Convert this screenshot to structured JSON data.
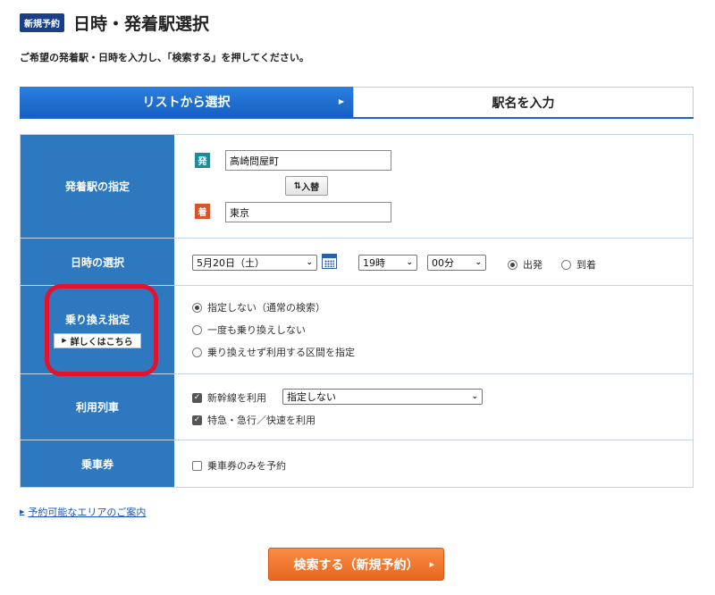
{
  "header": {
    "badge": "新規予約",
    "title": "日時・発着駅選択"
  },
  "instruction": "ご希望の発着駅・日時を入力し、「検索する」を押してください。",
  "tabs": {
    "list_label": "リストから選択",
    "name_label": "駅名を入力"
  },
  "rows": {
    "stations": {
      "label": "発着駅の指定",
      "departure_tag": "発",
      "departure_value": "高崎問屋町",
      "swap_label": "入替",
      "arrival_tag": "着",
      "arrival_value": "東京"
    },
    "datetime": {
      "label": "日時の選択",
      "date_value": "5月20日（土）",
      "hour_value": "19時",
      "minute_value": "00分",
      "departure_radio": "出発",
      "arrival_radio": "到着"
    },
    "transfer": {
      "label": "乗り換え指定",
      "detail_button": "詳しくはこちら",
      "options": [
        "指定しない（通常の検索）",
        "一度も乗り換えしない",
        "乗り換えせず利用する区間を指定"
      ]
    },
    "train": {
      "label": "利用列車",
      "shinkansen_label": "新幹線を利用",
      "shinkansen_select": "指定しない",
      "express_label": "特急・急行／快速を利用"
    },
    "ticket": {
      "label": "乗車券",
      "option": "乗車券のみを予約"
    }
  },
  "link_text": "予約可能なエリアのご案内",
  "search_button": "検索する（新規予約）",
  "colors": {
    "primary_blue": "#2e78c0",
    "tab_blue": "#1a66c4",
    "search_orange": "#f47a2c",
    "highlight_red": "#e3122f",
    "badge_navy": "#1a3f87"
  }
}
